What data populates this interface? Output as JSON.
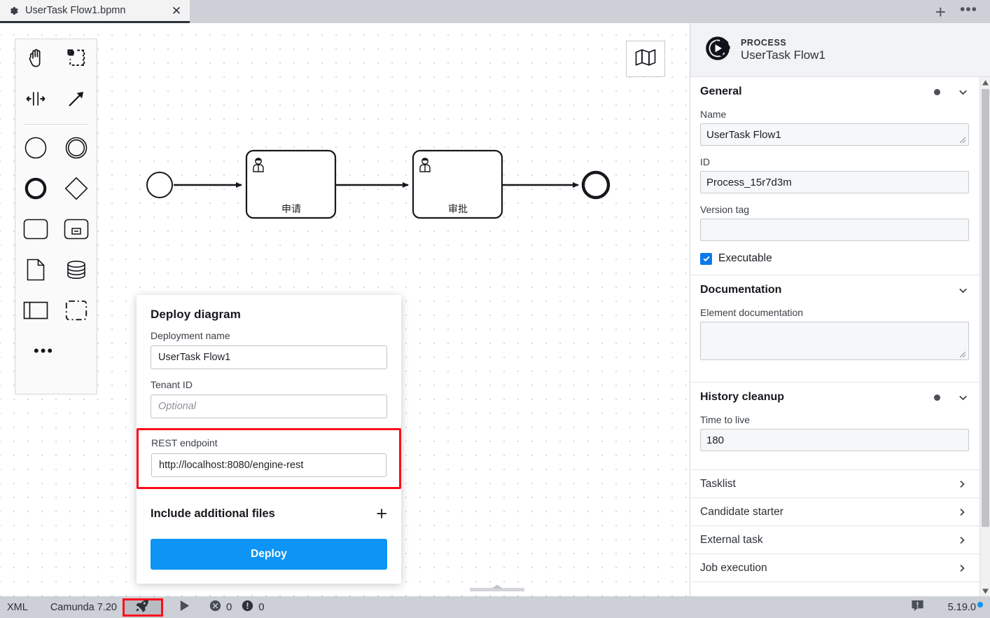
{
  "tabbar": {
    "tab": {
      "icon": "gear-icon",
      "title": "UserTask Flow1.bpmn",
      "close": "✕"
    },
    "new_tab_label": "+",
    "more_label": "•••"
  },
  "palette": {
    "items": [
      {
        "name": "hand-tool",
        "icon": "hand-icon"
      },
      {
        "name": "lasso-tool",
        "icon": "lasso-icon"
      },
      {
        "name": "space-tool",
        "icon": "space-tool-icon"
      },
      {
        "name": "global-connect-tool",
        "icon": "arrow-connect-icon"
      },
      {
        "name": "create-start-event",
        "icon": "circle-thin-icon"
      },
      {
        "name": "create-intermediate-event",
        "icon": "circle-double-icon"
      },
      {
        "name": "create-end-event",
        "icon": "circle-thick-icon"
      },
      {
        "name": "create-gateway",
        "icon": "diamond-icon"
      },
      {
        "name": "create-task",
        "icon": "rounded-rect-icon"
      },
      {
        "name": "create-subprocess",
        "icon": "subprocess-icon"
      },
      {
        "name": "create-data-object",
        "icon": "document-icon"
      },
      {
        "name": "create-data-store",
        "icon": "database-icon"
      },
      {
        "name": "create-participant",
        "icon": "pool-icon"
      },
      {
        "name": "create-group",
        "icon": "dashed-rect-icon"
      }
    ],
    "more_label": "•••"
  },
  "canvas": {
    "minimap_toggle": "map-icon",
    "diagram": {
      "start_event": {
        "label": ""
      },
      "task1": {
        "label": "申请",
        "type": "user-task"
      },
      "task2": {
        "label": "审批",
        "type": "user-task"
      },
      "end_event": {
        "label": ""
      }
    }
  },
  "deploy_dialog": {
    "title": "Deploy diagram",
    "deployment_name": {
      "label": "Deployment name",
      "value": "UserTask Flow1",
      "placeholder": ""
    },
    "tenant_id": {
      "label": "Tenant ID",
      "value": "",
      "placeholder": "Optional"
    },
    "rest_endpoint": {
      "label": "REST endpoint",
      "value": "http://localhost:8080/engine-rest",
      "placeholder": "",
      "highlight_color": "#fc0d1b"
    },
    "include_additional_files": {
      "label": "Include additional files",
      "add_label": "+"
    },
    "deploy_button": {
      "label": "Deploy",
      "color": "#0d94f4"
    }
  },
  "properties": {
    "header": {
      "kind": "PROCESS",
      "name": "UserTask Flow1",
      "icon": "process-gear-icon"
    },
    "general": {
      "title": "General",
      "name": {
        "label": "Name",
        "value": "UserTask Flow1"
      },
      "id": {
        "label": "ID",
        "value": "Process_15r7d3m"
      },
      "version_tag": {
        "label": "Version tag",
        "value": ""
      },
      "executable": {
        "label": "Executable",
        "checked": true
      }
    },
    "documentation": {
      "title": "Documentation",
      "element_documentation": {
        "label": "Element documentation",
        "value": ""
      }
    },
    "history_cleanup": {
      "title": "History cleanup",
      "time_to_live": {
        "label": "Time to live",
        "value": "180"
      }
    },
    "links": [
      {
        "label": "Tasklist"
      },
      {
        "label": "Candidate starter"
      },
      {
        "label": "External task"
      },
      {
        "label": "Job execution"
      }
    ]
  },
  "statusbar": {
    "xml": "XML",
    "engine": "Camunda 7.20",
    "deploy_icon": "rocket-icon",
    "run_icon": "play-icon",
    "errors": {
      "icon": "error-circle-icon",
      "count": "0"
    },
    "warnings": {
      "icon": "warning-circle-icon",
      "count": "0"
    },
    "log_icon": "log-icon",
    "version": "5.19.0",
    "version_dot_color": "#0d94f4"
  }
}
